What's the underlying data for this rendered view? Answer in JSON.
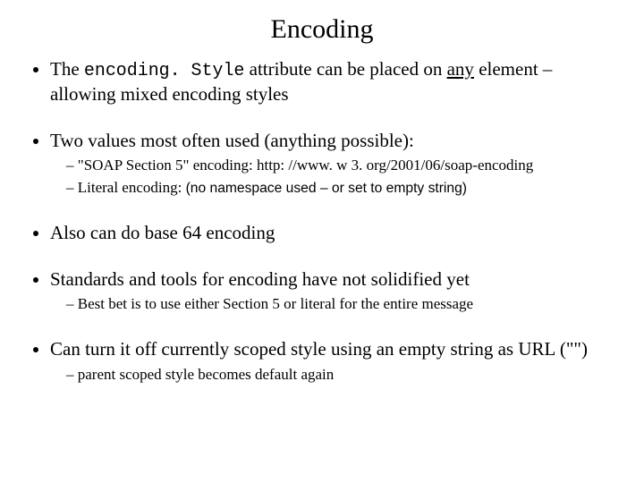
{
  "title": "Encoding",
  "bullets": {
    "b1": {
      "pre": "The ",
      "code": "encoding. Style",
      "mid": " attribute can be placed on ",
      "underlined": "any",
      "post": " element – allowing mixed  encoding styles"
    },
    "b2": {
      "text": "Two values most often used (anything possible):",
      "sub1": "\"SOAP Section 5\" encoding: http: //www. w 3. org/2001/06/soap-encoding",
      "sub2_pre": "Literal encoding: ",
      "sub2_sans": "(no namespace used – or set to empty string)"
    },
    "b3": {
      "text": "Also can do base 64 encoding"
    },
    "b4": {
      "text": "Standards and tools for encoding have not solidified yet",
      "sub1": " Best bet is to use either Section 5 or literal for the entire message"
    },
    "b5": {
      "text": "Can turn it off currently scoped style using an empty string as URL (\"\")",
      "sub1": "parent scoped style becomes default again"
    }
  }
}
